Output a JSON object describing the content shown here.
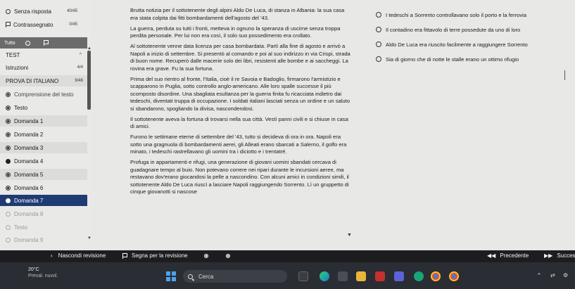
{
  "sidebar": {
    "unanswered": {
      "label": "Senza risposta",
      "count": "40/45"
    },
    "flagged": {
      "label": "Contrassegnato",
      "count": "0/45"
    },
    "toolbar": {
      "label": "Tutto"
    },
    "test": {
      "label": "TEST",
      "chevron": "^"
    },
    "instructions": {
      "label": "Istruzioni",
      "count": "4/4"
    },
    "exam": {
      "label": "PROVA DI ITALIANO",
      "count": "9/46"
    },
    "section": {
      "label": "Comprensione del testo"
    },
    "items": [
      {
        "label": "Testo"
      },
      {
        "label": "Domanda 1"
      },
      {
        "label": "Domanda 2"
      },
      {
        "label": "Domanda 3"
      },
      {
        "label": "Domanda 4"
      },
      {
        "label": "Domanda 5"
      },
      {
        "label": "Domanda 6"
      },
      {
        "label": "Domanda 7"
      },
      {
        "label": "Domanda 8"
      },
      {
        "label": "Testo"
      },
      {
        "label": "Domanda 9"
      }
    ]
  },
  "text": {
    "paragraphs": [
      "Brutta notizia per il sottotenente degli alpini Aldo De Luca, di stanza in Albania: la sua casa era stata colpita dai fitti bombardamenti dell'agosto del '43.",
      "La guerra, perduta su tutti i fronti, metteva in ognuno la speranza di uscirne senza troppa perdita personale. Per lui non era così, il solo suo possedimento era crollato.",
      "Al sottotenente venne data licenza per casa bombardata. Partì alla fine di agosto e arrivò a Napoli a inizio di settembre. Si presentò al comando e poi al suo indirizzo in via Crispi, strada di buon nome. Recuperò dalle macerie solo dei libri, resistenti alle bombe e ai saccheggi. La rovina era grave. Fu la sua fortuna.",
      "Prima del suo rientro al fronte, l'Italia, cioè il re Savoia e Badoglio, firmarono l'armistizio e scapparono in Puglia, sotto controllo anglo-americano. Alle loro spalle successe il più scomposto disordine. Una sbagliata esultanza per la guerra finita fu ricacciata indietro dai tedeschi, diventati truppa di occupazione. I soldati italiani lasciati senza un ordine e un saluto si sbandarono, spogliando la divisa, nascondendosi.",
      "Il sottotenente aveva la fortuna di trovarsi nella sua città. Vestì panni civili e si chiuse in casa di amici.",
      "Furono le settimane eterne di settembre del '43, tutto si decideva di ora in ora. Napoli era sotto una gragnuola di bombardamenti aerei, gli Alleati erano sbarcati a Salerno, il golfo era minato, i tedeschi rastrellavano gli uomini tra i diciotto e i trentatré.",
      "Profuga in appartamenti e rifugi, una generazione di giovani uomini sbandati cercava di guadagnare tempo al buio. Non potevano correre nei ripari durante le incursioni aeree, ma restavano dov'erano giocandosi la pelle a nascondino. Con alcuni amici in condizioni simili, il sottotenente Aldo De Luca riuscì a lasciare Napoli raggiungendo Sorrento. Lì un gruppetto di cinque giovanotti si nascose"
    ]
  },
  "options": [
    "I tedeschi a Sorrento controllavano solo il porto e la ferrovia",
    "Il contadino era fittavolo di terre possedute da uno di loro",
    "Aldo De Luca era riuscito facilmente a raggiungere Sorrento",
    "Sia di giorno che di notte le stalle erano un ottimo rifugio"
  ],
  "bottom_bar": {
    "hide_review": "Nascondi revisione",
    "mark_review": "Segna per la revisione",
    "previous": "Precedente",
    "next": "Succes"
  },
  "taskbar": {
    "temperature": "20°C",
    "weather": "Preval. nuvol.",
    "search": "Cerca"
  }
}
